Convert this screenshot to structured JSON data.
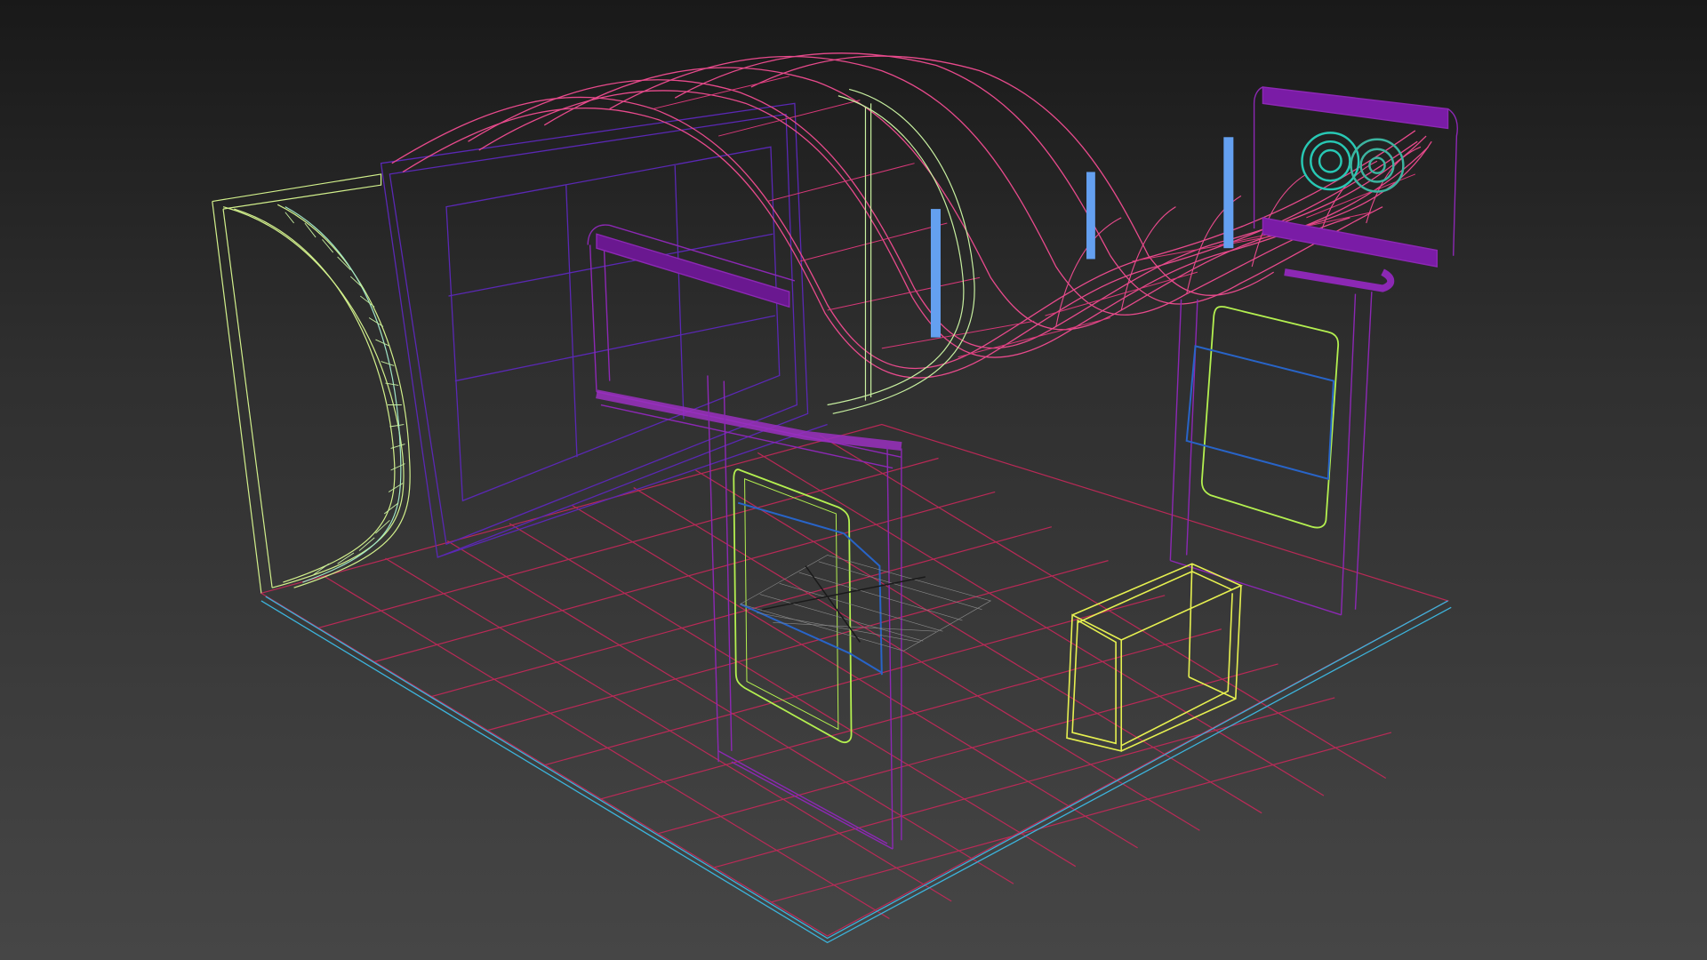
{
  "viewport": {
    "background_top": "#191919",
    "background_bottom": "#464646",
    "render_mode": "wireframe"
  },
  "scene_objects": [
    {
      "id": "floor-grid",
      "color": "#c8285a"
    },
    {
      "id": "floor-edge",
      "color": "#3cb4dc"
    },
    {
      "id": "back-wall-panel",
      "color": "#5a28b4"
    },
    {
      "id": "left-curved-wall",
      "color": "#d2f08c"
    },
    {
      "id": "wave-canopy",
      "color": "#e84a8c"
    },
    {
      "id": "front-arch-frame",
      "color": "#8c28b4"
    },
    {
      "id": "right-arch-frame",
      "color": "#8c28b4"
    },
    {
      "id": "front-display-screen",
      "color": "#b4f050"
    },
    {
      "id": "right-display-screen",
      "color": "#b4f050"
    },
    {
      "id": "counter-box",
      "color": "#e6f050"
    },
    {
      "id": "ceiling-lights",
      "color": "#64a0f0"
    },
    {
      "id": "spiral-logo",
      "color": "#28c8b4"
    },
    {
      "id": "pivot-grid-gizmo",
      "color": "#9a9a9a"
    }
  ]
}
